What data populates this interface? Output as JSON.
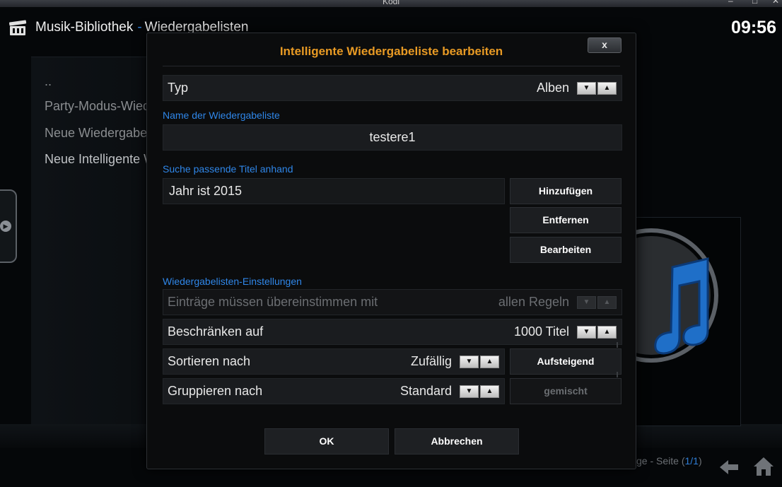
{
  "window": {
    "title": "Kodi",
    "controls": [
      "–",
      "□",
      "✕"
    ]
  },
  "header": {
    "section": "Musik-Bibliothek",
    "separator": "-",
    "subsection": "Wiedergabelisten"
  },
  "clock": "09:56",
  "sidebar": {
    "items": [
      {
        "label": ".."
      },
      {
        "label": "Party-Modus-Wied"
      },
      {
        "label": "Neue Wiedergabe"
      },
      {
        "label": "Neue Intelligente W"
      }
    ]
  },
  "footer": {
    "page_text": "ge - Seite (",
    "page_num": "1/1",
    "page_close": ")"
  },
  "dialog": {
    "title": "Intelligente Wiedergabeliste bearbeiten",
    "close_label": "x",
    "type": {
      "label": "Typ",
      "value": "Alben"
    },
    "name_section": "Name der Wiedergabeliste",
    "name_value": "testere1",
    "rules_section": "Suche passende Titel anhand",
    "rule": "Jahr ist 2015",
    "add_button": "Hinzufügen",
    "remove_button": "Entfernen",
    "edit_button": "Bearbeiten",
    "settings_section": "Wiedergabelisten-Einstellungen",
    "match": {
      "label": "Einträge müssen übereinstimmen mit",
      "value": "allen Regeln",
      "enabled": false
    },
    "limit": {
      "label": "Beschränken auf",
      "value": "1000 Titel"
    },
    "sort": {
      "label": "Sortieren nach",
      "value": "Zufällig",
      "order_button": "Aufsteigend"
    },
    "group": {
      "label": "Gruppieren nach",
      "value": "Standard",
      "mixed_button": "gemischt",
      "mixed_enabled": false
    },
    "ok_button": "OK",
    "cancel_button": "Abbrechen",
    "spin_down": "▼",
    "spin_up": "▲"
  },
  "colors": {
    "accent_title": "#e89a24",
    "section_blue": "#2f86e8",
    "background": "#050709"
  },
  "icons": [
    "kodi-logo-icon",
    "close-icon",
    "chevron-right-icon",
    "spin-down-icon",
    "spin-up-icon",
    "back-arrow-icon",
    "home-icon",
    "music-note-icon"
  ]
}
